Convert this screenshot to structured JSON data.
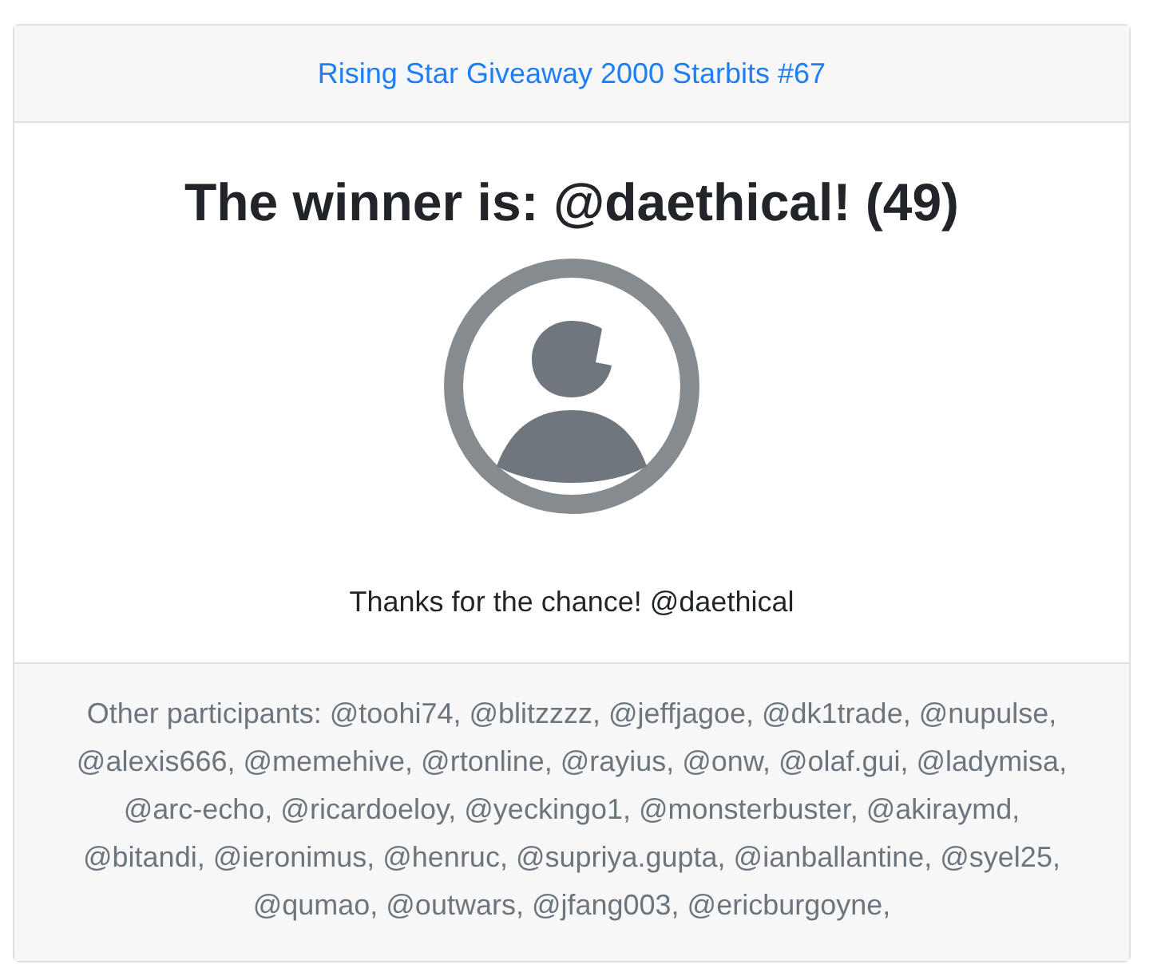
{
  "header": {
    "title": "Rising Star Giveaway 2000 Starbits #67"
  },
  "body": {
    "winner": "The winner is: @daethical! (49)",
    "message": "Thanks for the chance! @daethical"
  },
  "footer": {
    "participants": "Other participants: @toohi74, @blitzzzz, @jeffjagoe, @dk1trade, @nupulse, @alexis666, @memehive, @rtonline, @rayius, @onw, @olaf.gui, @ladymisa, @arc-echo, @ricardoeloy, @yeckingo1, @monsterbuster, @akiraymd, @bitandi, @ieronimus, @henruc, @supriya.gupta, @ianballantine, @syel25, @qumao, @outwars, @jfang003, @ericburgoyne,"
  }
}
